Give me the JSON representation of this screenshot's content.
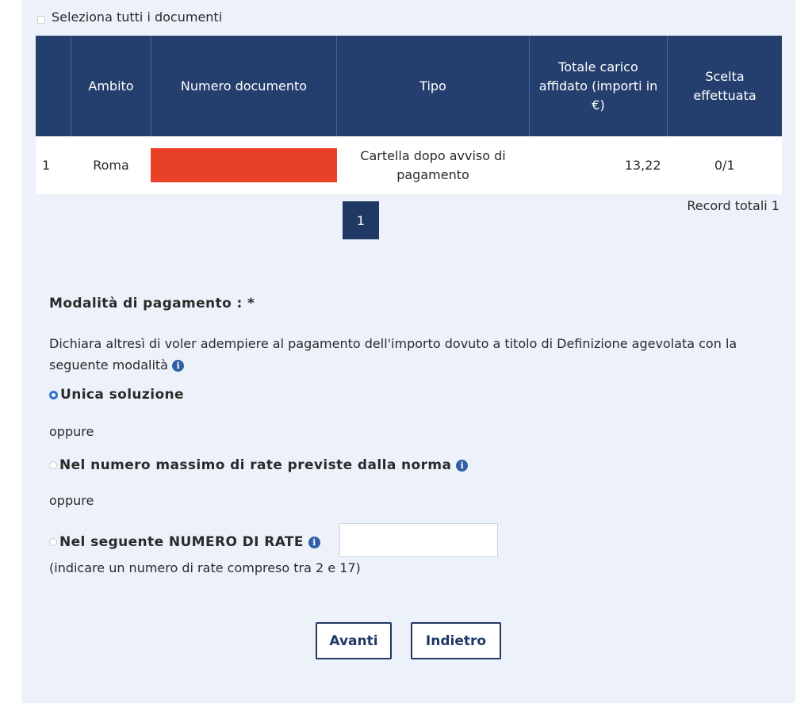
{
  "select_all_label": "Seleziona tutti i documenti",
  "table": {
    "headers": [
      "",
      "Ambito",
      "Numero documento",
      "Tipo",
      "Totale carico affidato (importi in €)",
      "Scelta effettuata"
    ],
    "rows": [
      {
        "index": "1",
        "ambito": "Roma",
        "numero_documento": "",
        "tipo": "Cartella dopo avviso di pagamento",
        "totale": "13,22",
        "scelta": "0/1"
      }
    ]
  },
  "pagination": {
    "current_page": "1",
    "record_totali": "Record totali 1"
  },
  "payment": {
    "title": "Modalità di pagamento : *",
    "declaration": "Dichiara altresì di voler adempiere al pagamento dell'importo dovuto a titolo di Definizione agevolata con la seguente modalità",
    "options": [
      {
        "label": "Unica soluzione",
        "selected": true
      },
      {
        "label": "Nel numero massimo di rate previste dalla norma",
        "selected": false
      },
      {
        "label": "Nel seguente NUMERO DI RATE",
        "selected": false
      }
    ],
    "separator": "oppure",
    "rate_input_value": "",
    "hint": "(indicare un numero di rate compreso tra 2 e 17)"
  },
  "buttons": {
    "next": "Avanti",
    "back": "Indietro"
  },
  "colors": {
    "header_bg": "#243f6e",
    "panel_bg": "#edf2fa",
    "redaction": "#e84128",
    "accent": "#1f3864"
  },
  "icons": {
    "info": "info-circle-icon"
  }
}
